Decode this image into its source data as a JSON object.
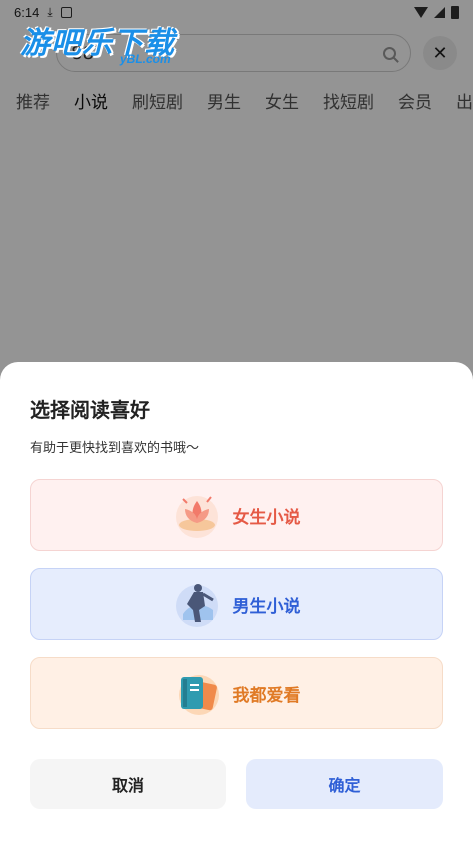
{
  "status_bar": {
    "time": "6:14"
  },
  "watermark": {
    "text": "游吧乐下载",
    "sub": "yBL.com"
  },
  "search": {
    "text": "88"
  },
  "tabs": [
    {
      "label": "推荐"
    },
    {
      "label": "小说"
    },
    {
      "label": "刷短剧"
    },
    {
      "label": "男生"
    },
    {
      "label": "女生"
    },
    {
      "label": "找短剧"
    },
    {
      "label": "会员"
    },
    {
      "label": "出"
    }
  ],
  "sheet": {
    "title": "选择阅读喜好",
    "subtitle": "有助于更快找到喜欢的书哦～",
    "options": [
      {
        "label": "女生小说",
        "icon": "lotus-icon"
      },
      {
        "label": "男生小说",
        "icon": "warrior-icon"
      },
      {
        "label": "我都爱看",
        "icon": "book-icon"
      }
    ],
    "cancel": "取消",
    "confirm": "确定"
  },
  "colors": {
    "female": "#e55a46",
    "male": "#2f5fd6",
    "all": "#e07a25"
  }
}
